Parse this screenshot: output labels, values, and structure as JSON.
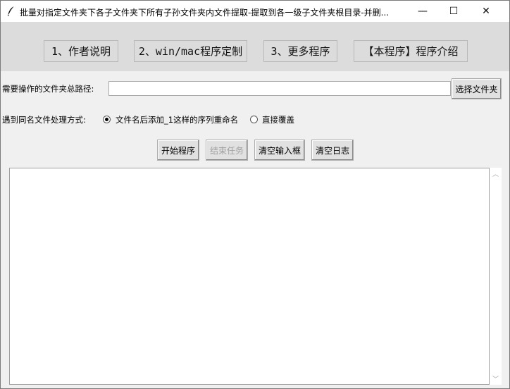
{
  "window": {
    "title": "批量对指定文件夹下各子文件夹下所有子孙文件夹内文件提取-提取到各一级子文件夹根目录-并删...",
    "icon": "feather-icon",
    "controls": {
      "minimize": "—",
      "maximize": "☐",
      "close": "✕"
    }
  },
  "menu": {
    "items": [
      {
        "label": "1、作者说明"
      },
      {
        "label": "2、win/mac程序定制"
      },
      {
        "label": "3、更多程序"
      },
      {
        "label": "【本程序】程序介绍"
      }
    ]
  },
  "path": {
    "label": "需要操作的文件夹总路径:",
    "value": "",
    "browse_button": "选择文件夹"
  },
  "conflict": {
    "label": "遇到同名文件处理方式:",
    "options": [
      {
        "label": "文件名后添加_1这样的序列重命名",
        "selected": true
      },
      {
        "label": "直接覆盖",
        "selected": false
      }
    ]
  },
  "actions": {
    "start": "开始程序",
    "stop": "结束任务",
    "clear_input": "清空输入框",
    "clear_log": "清空日志"
  },
  "log": {
    "text": ""
  },
  "colors": {
    "menubar_bg": "#dcdcdc",
    "window_bg": "#f0f0f0",
    "disabled_text": "#a0a0a0"
  }
}
